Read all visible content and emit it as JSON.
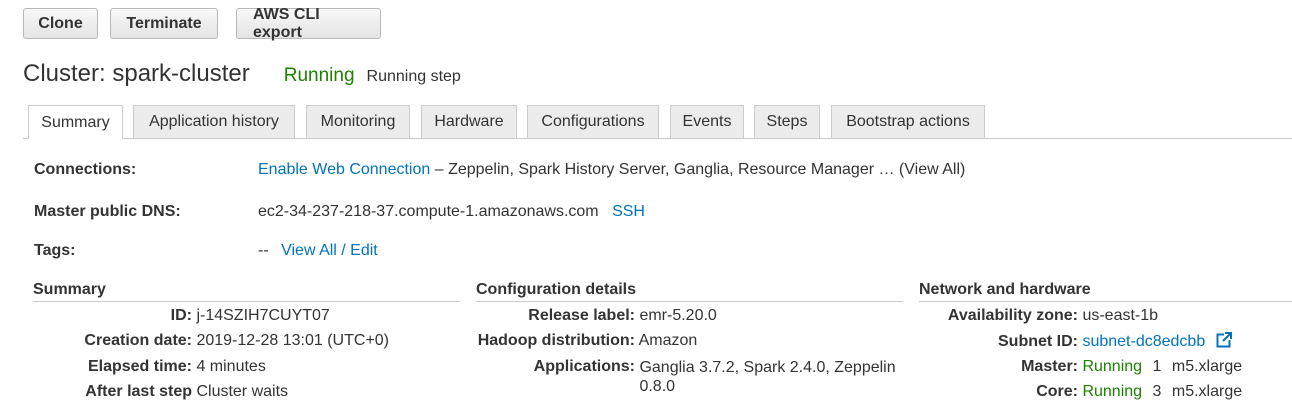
{
  "toolbar": {
    "clone": "Clone",
    "terminate": "Terminate",
    "cli_export": "AWS CLI export"
  },
  "header": {
    "title": "Cluster: spark-cluster",
    "status": "Running",
    "substatus": "Running step"
  },
  "tabs": [
    "Summary",
    "Application history",
    "Monitoring",
    "Hardware",
    "Configurations",
    "Events",
    "Steps",
    "Bootstrap actions"
  ],
  "connections": {
    "label": "Connections:",
    "link": "Enable Web Connection",
    "text": "– Zeppelin, Spark History Server, Ganglia, Resource Manager … (View All)"
  },
  "dns": {
    "label": "Master public DNS:",
    "value": "ec2-34-237-218-37.compute-1.amazonaws.com",
    "ssh": "SSH"
  },
  "tags": {
    "label": "Tags:",
    "dash": "--",
    "link": "View All / Edit"
  },
  "summary": {
    "title": "Summary",
    "id_k": "ID:",
    "id_v": "j-14SZIH7CUYT07",
    "created_k": "Creation date:",
    "created_v": "2019-12-28 13:01 (UTC+0)",
    "elapsed_k": "Elapsed time:",
    "elapsed_v": "4 minutes",
    "after_k": "After last step",
    "after_v": "Cluster waits"
  },
  "config": {
    "title": "Configuration details",
    "release_k": "Release label:",
    "release_v": "emr-5.20.0",
    "hadoop_k": "Hadoop distribution:",
    "hadoop_v": "Amazon",
    "apps_k": "Applications:",
    "apps_v1": "Ganglia 3.7.2, Spark 2.4.0, Zeppelin",
    "apps_v2": "0.8.0"
  },
  "network": {
    "title": "Network and hardware",
    "az_k": "Availability zone:",
    "az_v": "us-east-1b",
    "subnet_k": "Subnet ID:",
    "subnet_v": "subnet-dc8edcbb",
    "master_k": "Master:",
    "master_status": "Running",
    "master_count": "1",
    "master_type": "m5.xlarge",
    "core_k": "Core:",
    "core_status": "Running",
    "core_count": "3",
    "core_type": "m5.xlarge"
  },
  "icons": {
    "external_link": "external-link-icon"
  },
  "colors": {
    "link": "#0073bb",
    "running": "#1d8102"
  }
}
